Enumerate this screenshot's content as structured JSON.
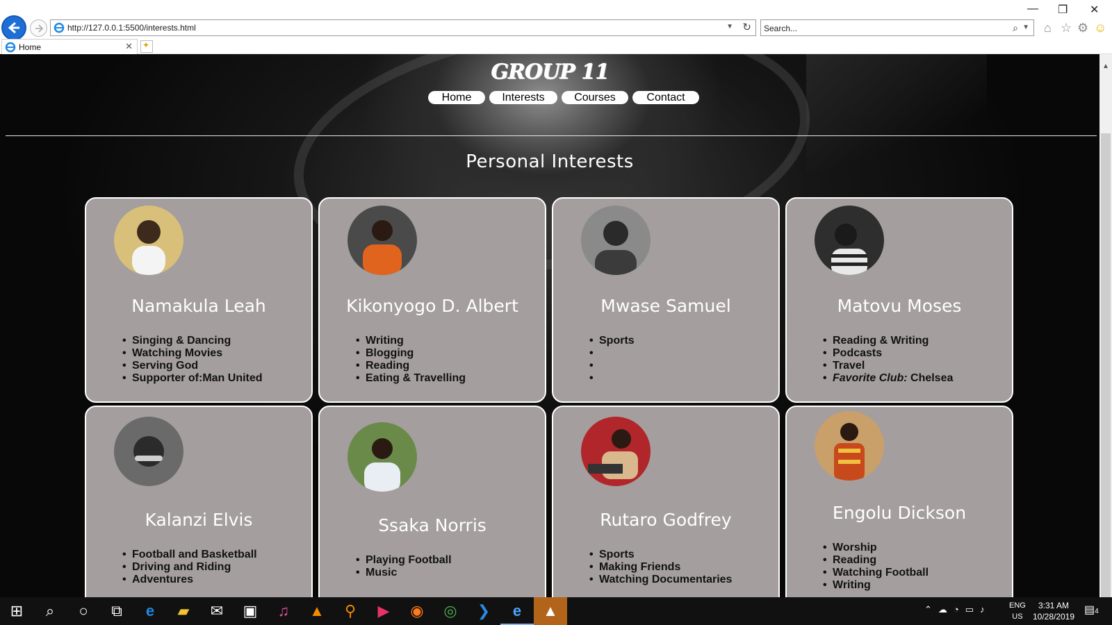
{
  "browser": {
    "url": "http://127.0.0.1:5500/interests.html",
    "search_placeholder": "Search...",
    "tab_title": "Home"
  },
  "page": {
    "brand": "GROUP 11",
    "nav": [
      {
        "label": "Home"
      },
      {
        "label": "Interests"
      },
      {
        "label": "Courses"
      },
      {
        "label": "Contact"
      }
    ],
    "title": "Personal Interests",
    "cards": [
      {
        "name": "Namakula Leah",
        "interests": [
          "Singing & Dancing",
          "Watching Movies",
          "Serving God",
          "Supporter of:Man United"
        ],
        "avatar_color": "#d8c07a"
      },
      {
        "name": "Kikonyogo D. Albert",
        "interests": [
          "Writing",
          "Blogging",
          "Reading",
          "Eating & Travelling"
        ],
        "avatar_color": "#e0641e"
      },
      {
        "name": "Mwase Samuel",
        "interests": [
          "Sports",
          "",
          "",
          ""
        ],
        "avatar_color": "#6e6e6e"
      },
      {
        "name": "Matovu Moses",
        "interests": [
          "Reading & Writing",
          "Podcasts",
          "Travel"
        ],
        "favorite_label": "Favorite Club:",
        "favorite_value": " Chelsea",
        "avatar_color": "#3a3a3a"
      },
      {
        "name": "Kalanzi Elvis",
        "interests": [
          "Football and Basketball",
          "Driving and Riding",
          "Adventures"
        ],
        "avatar_color": "#555555"
      },
      {
        "name": "Ssaka Norris",
        "interests": [
          "Playing Football",
          "Music"
        ],
        "avatar_color": "#6a8a4a"
      },
      {
        "name": "Rutaro Godfrey",
        "interests": [
          "Sports",
          "Making Friends",
          "Watching Documentaries"
        ],
        "avatar_color": "#b0262a"
      },
      {
        "name": "Engolu Dickson",
        "interests": [
          "Worship",
          "Reading",
          "Watching Football",
          "Writing"
        ],
        "avatar_color": "#c84a1c"
      }
    ]
  },
  "taskbar": {
    "lang_line1": "ENG",
    "lang_line2": "US",
    "time": "3:31 AM",
    "date": "10/28/2019",
    "notif_count": "4"
  },
  "colors": {
    "card_bg": "#a49e9e",
    "page_bg": "#070707",
    "accent": "#1d6fd6"
  }
}
